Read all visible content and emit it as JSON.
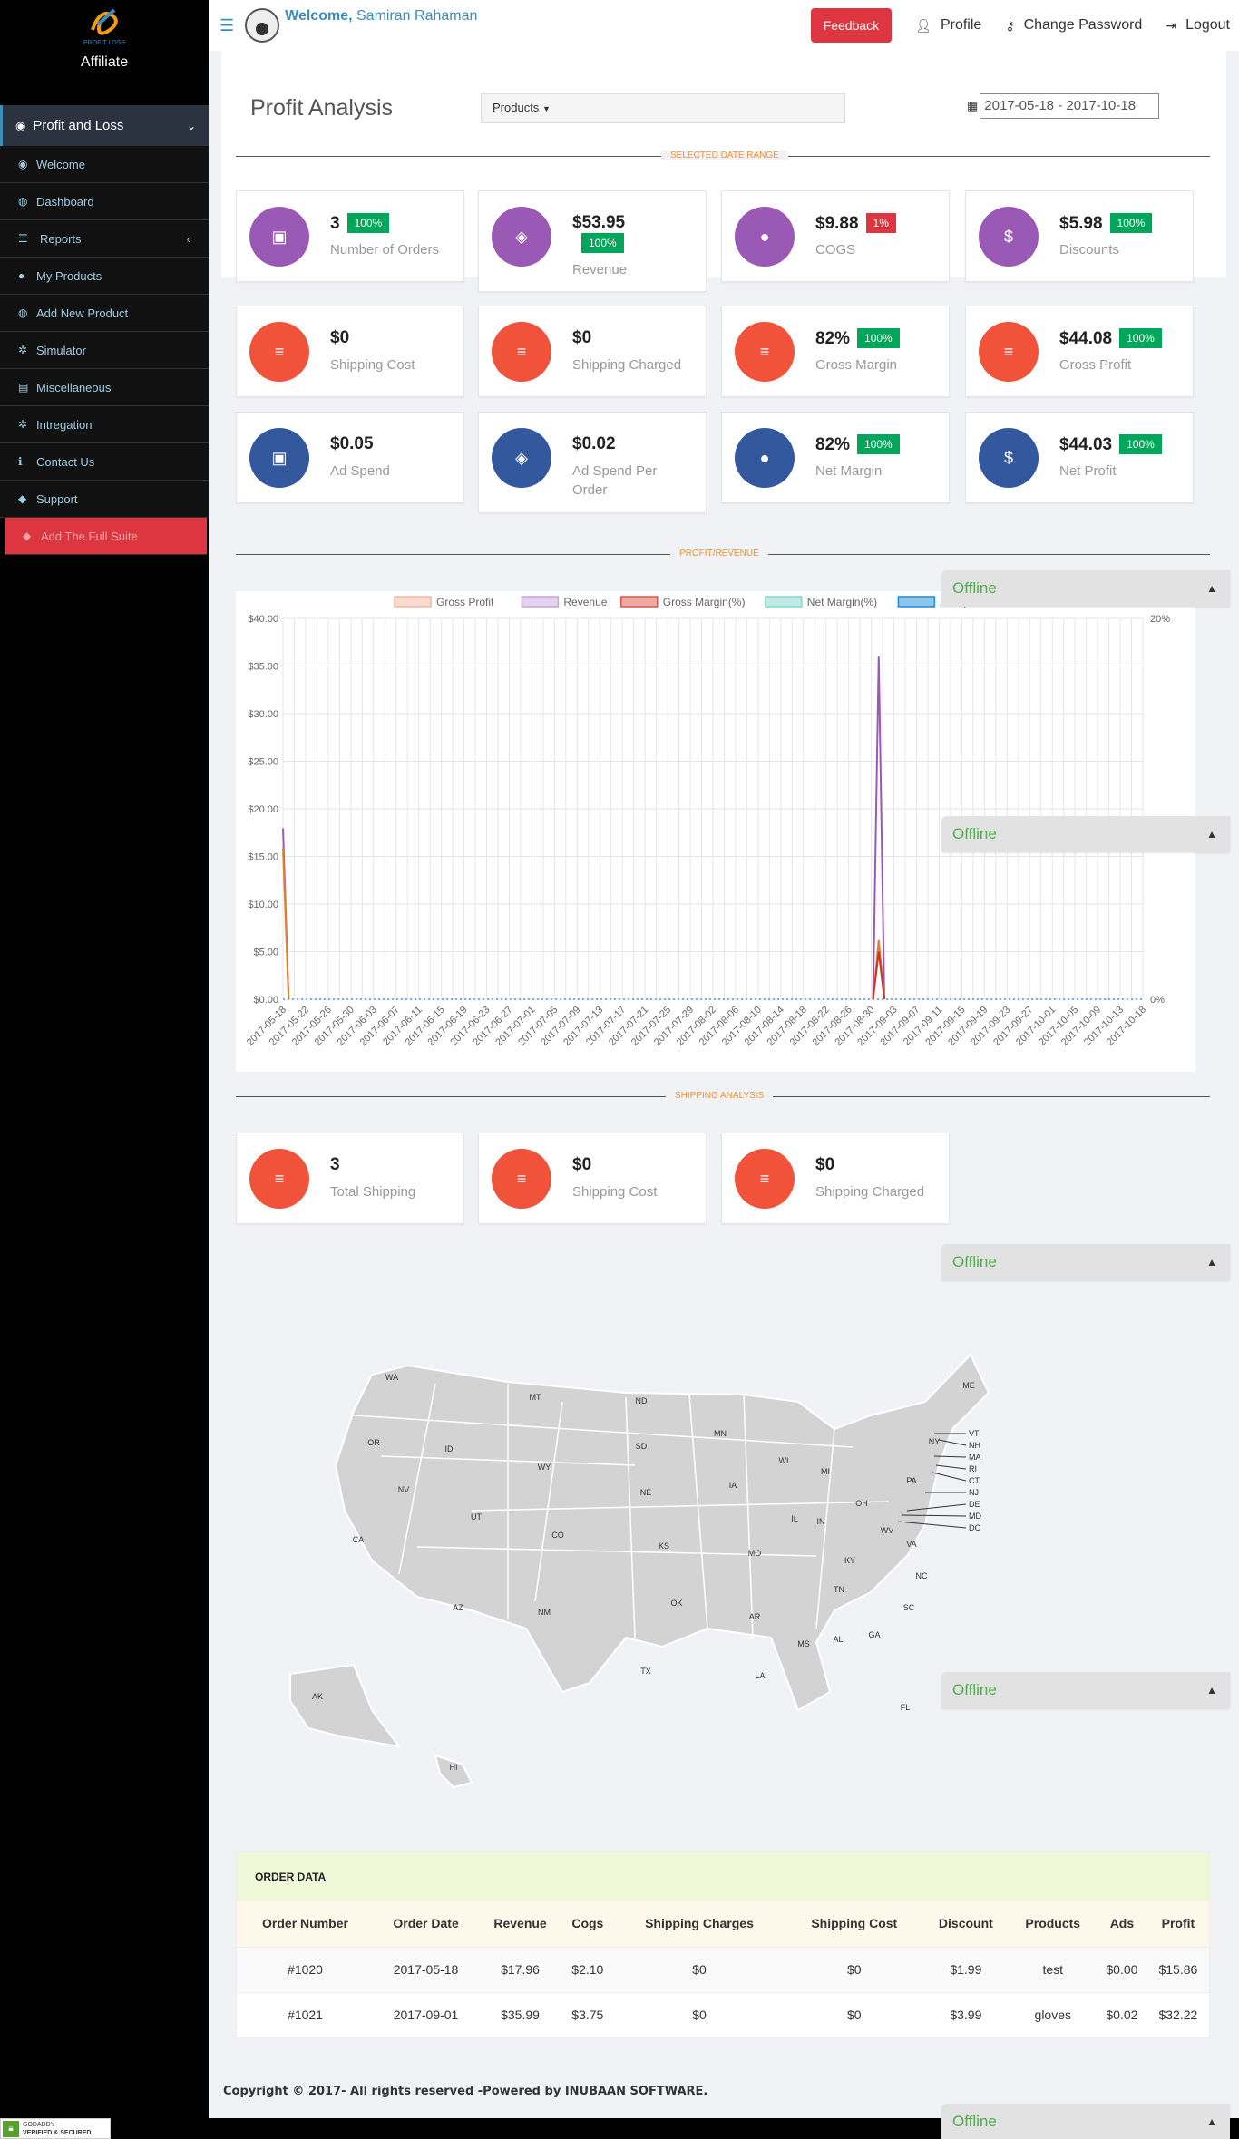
{
  "brand": {
    "sub": "Affiliate",
    "logo_text": "PROFIT LOSS"
  },
  "sidebar": {
    "active": {
      "label": "Profit and Loss"
    },
    "items": [
      {
        "label": "Welcome"
      },
      {
        "label": "Dashboard"
      },
      {
        "label": "Reports"
      },
      {
        "label": "My Products"
      },
      {
        "label": "Add New Product"
      },
      {
        "label": "Simulator"
      },
      {
        "label": "Miscellaneous"
      },
      {
        "label": "Intregation"
      },
      {
        "label": "Contact Us"
      },
      {
        "label": "Support"
      },
      {
        "label": "Add The Full Suite"
      }
    ]
  },
  "topbar": {
    "welcome": "Welcome,",
    "user": "Samiran Rahaman",
    "feedback": "Feedback",
    "profile": "Profile",
    "change_password": "Change Password",
    "logout": "Logout"
  },
  "page": {
    "title": "Profit Analysis",
    "products_dropdown": "Products",
    "date_range": "2017-05-18 - 2017-10-18",
    "section_selected": "SELECTED DATE RANGE",
    "section_profit": "PROFIT/REVENUE",
    "section_shipping": "SHIPPING ANALYSIS"
  },
  "cards": [
    {
      "value": "3",
      "badge": "100%",
      "label": "Number of Orders"
    },
    {
      "value": "$53.95",
      "badge": "100%",
      "label": "Revenue"
    },
    {
      "value": "$9.88",
      "badge": "1%",
      "label": "COGS"
    },
    {
      "value": "$5.98",
      "badge": "100%",
      "label": "Discounts"
    },
    {
      "value": "$0",
      "label": "Shipping Cost"
    },
    {
      "value": "$0",
      "label": "Shipping Charged"
    },
    {
      "value": "82%",
      "badge": "100%",
      "label": "Gross Margin"
    },
    {
      "value": "$44.08",
      "badge": "100%",
      "label": "Gross Profit"
    },
    {
      "value": "$0.05",
      "label": "Ad Spend"
    },
    {
      "value": "$0.02",
      "label": "Ad Spend Per Order"
    },
    {
      "value": "82%",
      "badge": "100%",
      "label": "Net Margin"
    },
    {
      "value": "$44.03",
      "badge": "100%",
      "label": "Net Profit"
    }
  ],
  "shipping_cards": [
    {
      "value": "3",
      "label": "Total Shipping"
    },
    {
      "value": "$0",
      "label": "Shipping Cost"
    },
    {
      "value": "$0",
      "label": "Shipping Charged"
    }
  ],
  "offline_label": "Offline",
  "chart_data": {
    "type": "line",
    "legend": [
      "Gross Profit",
      "Revenue",
      "Gross Margin(%)",
      "Net Margin(%)",
      "Ad Spend"
    ],
    "legend_colors": [
      "#f4b6a0",
      "#c9a3dd",
      "#e0534a",
      "#7fd6d0",
      "#1a8cd8"
    ],
    "y_ticks": [
      "$40.00",
      "$35.00",
      "$30.00",
      "$25.00",
      "$20.00",
      "$15.00",
      "$10.00",
      "$5.00",
      "$0.00"
    ],
    "y2_ticks": [
      "20%",
      "0%"
    ],
    "ylim": [
      0,
      40
    ],
    "x_labels": [
      "2017-05-18",
      "2017-05-22",
      "2017-05-26",
      "2017-05-30",
      "2017-06-03",
      "2017-06-07",
      "2017-06-11",
      "2017-06-15",
      "2017-06-19",
      "2017-06-23",
      "2017-06-27",
      "2017-07-01",
      "2017-07-05",
      "2017-07-09",
      "2017-07-13",
      "2017-07-17",
      "2017-07-21",
      "2017-07-25",
      "2017-07-29",
      "2017-08-02",
      "2017-08-06",
      "2017-08-10",
      "2017-08-14",
      "2017-08-18",
      "2017-08-22",
      "2017-08-26",
      "2017-08-30",
      "2017-09-03",
      "2017-09-07",
      "2017-09-11",
      "2017-09-15",
      "2017-09-19",
      "2017-09-23",
      "2017-09-27",
      "2017-10-01",
      "2017-10-05",
      "2017-10-09",
      "2017-10-13",
      "2017-10-18"
    ],
    "series": [
      {
        "name": "Revenue",
        "color": "#9b59b6",
        "points": [
          [
            "2017-05-18",
            17.96
          ],
          [
            "2017-09-01",
            35.99
          ]
        ]
      },
      {
        "name": "Gross Profit",
        "color": "#e67e22",
        "points": [
          [
            "2017-05-18",
            15.86
          ],
          [
            "2017-09-01",
            6.2
          ]
        ]
      },
      {
        "name": "Gross Margin(%)",
        "color": "#c0392b",
        "points": [
          [
            "2017-09-01",
            5.0
          ]
        ]
      }
    ]
  },
  "map": {
    "states": [
      "WA",
      "OR",
      "CA",
      "ID",
      "NV",
      "MT",
      "WY",
      "UT",
      "AZ",
      "CO",
      "NM",
      "ND",
      "SD",
      "NE",
      "KS",
      "OK",
      "TX",
      "MN",
      "IA",
      "MO",
      "AR",
      "LA",
      "WI",
      "IL",
      "MI",
      "IN",
      "OH",
      "KY",
      "TN",
      "MS",
      "AL",
      "GA",
      "FL",
      "SC",
      "NC",
      "VA",
      "WV",
      "PA",
      "NY",
      "ME",
      "AK",
      "HI"
    ],
    "callouts": [
      "VT",
      "NH",
      "MA",
      "RI",
      "CT",
      "NJ",
      "DE",
      "MD",
      "DC"
    ]
  },
  "orders": {
    "title": "ORDER DATA",
    "columns": [
      "Order Number",
      "Order Date",
      "Revenue",
      "Cogs",
      "Shipping Charges",
      "Shipping Cost",
      "Discount",
      "Products",
      "Ads",
      "Profit"
    ],
    "rows": [
      [
        "#1020",
        "2017-05-18",
        "$17.96",
        "$2.10",
        "$0",
        "$0",
        "$1.99",
        "test",
        "$0.00",
        "$15.86"
      ],
      [
        "#1021",
        "2017-09-01",
        "$35.99",
        "$3.75",
        "$0",
        "$0",
        "$3.99",
        "gloves",
        "$0.02",
        "$32.22"
      ]
    ]
  },
  "footer": {
    "copyright": "Copyright © 2017- All rights reserved -Powered by INUBAAN SOFTWARE.",
    "godaddy_1": "GODADDY",
    "godaddy_2": "VERIFIED & SECURED"
  }
}
